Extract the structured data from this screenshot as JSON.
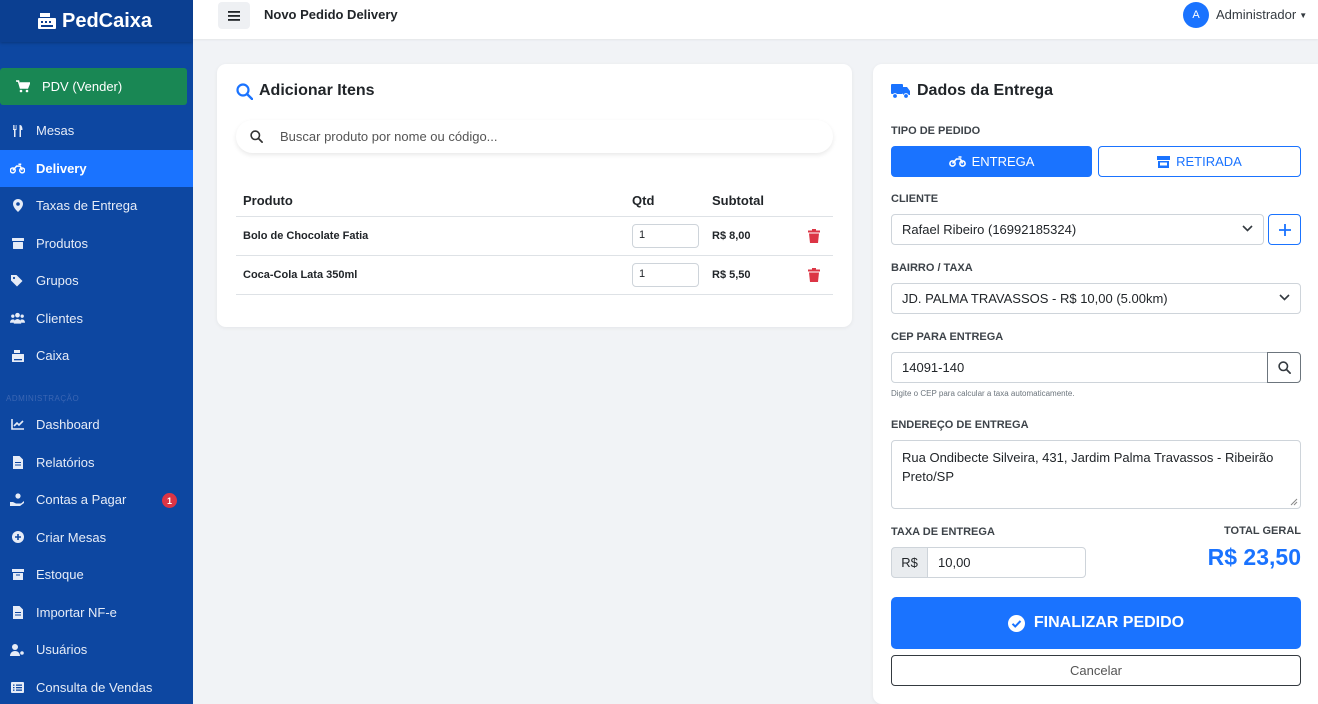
{
  "brand": {
    "name": "PedCaixa"
  },
  "sidebar": {
    "pdv_label": "PDV (Vender)",
    "section_label": "ADMINISTRAÇÃO",
    "items": [
      {
        "label": "Mesas",
        "icon": "utensils-icon"
      },
      {
        "label": "Delivery",
        "icon": "motorcycle-icon",
        "active": true
      },
      {
        "label": "Taxas de Entrega",
        "icon": "map-pin-icon"
      },
      {
        "label": "Produtos",
        "icon": "box-icon"
      },
      {
        "label": "Grupos",
        "icon": "tags-icon"
      },
      {
        "label": "Clientes",
        "icon": "users-icon"
      },
      {
        "label": "Caixa",
        "icon": "cash-register-icon"
      },
      {
        "label": "Dashboard",
        "icon": "chart-line-icon"
      },
      {
        "label": "Relatórios",
        "icon": "file-icon"
      },
      {
        "label": "Contas a Pagar",
        "icon": "hand-money-icon",
        "badge": "1"
      },
      {
        "label": "Criar Mesas",
        "icon": "plus-circle-icon"
      },
      {
        "label": "Estoque",
        "icon": "warehouse-icon"
      },
      {
        "label": "Importar NF-e",
        "icon": "file-import-icon"
      },
      {
        "label": "Usuários",
        "icon": "user-gear-icon"
      },
      {
        "label": "Consulta de Vendas",
        "icon": "list-icon"
      }
    ]
  },
  "topbar": {
    "title": "Novo Pedido Delivery",
    "avatar_letter": "A",
    "user": "Administrador"
  },
  "items_card": {
    "title": "Adicionar Itens",
    "search_placeholder": "Buscar produto por nome ou código...",
    "columns": [
      "Produto",
      "Qtd",
      "Subtotal"
    ],
    "rows": [
      {
        "name": "Bolo de Chocolate Fatia",
        "qty": "1",
        "subtotal": "R$ 8,00"
      },
      {
        "name": "Coca-Cola Lata 350ml",
        "qty": "1",
        "subtotal": "R$ 5,50"
      }
    ]
  },
  "delivery_card": {
    "title": "Dados da Entrega",
    "tipo_label": "TIPO DE PEDIDO",
    "tipo_entrega": "ENTREGA",
    "tipo_retirada": "RETIRADA",
    "cliente_label": "CLIENTE",
    "cliente_value": "Rafael Ribeiro (16992185324)",
    "bairro_label": "BAIRRO / TAXA",
    "bairro_value": "JD. PALMA TRAVASSOS - R$ 10,00 (5.00km)",
    "cep_label": "CEP PARA ENTREGA",
    "cep_value": "14091-140",
    "cep_hint": "Digite o CEP para calcular a taxa automaticamente.",
    "endereco_label": "ENDEREÇO DE ENTREGA",
    "endereco_value": "Rua Ondibecte Silveira, 431, Jardim Palma Travassos - Ribeirão Preto/SP",
    "taxa_label": "TAXA DE ENTREGA",
    "taxa_prefix": "R$",
    "taxa_value": "10,00",
    "total_label": "TOTAL GERAL",
    "total_value": "R$ 23,50",
    "finalize_label": "FINALIZAR PEDIDO",
    "cancel_label": "Cancelar"
  },
  "colors": {
    "primary": "#1a73ff",
    "sidebar": "#0d47a1",
    "success": "#198754",
    "danger": "#dc3545"
  }
}
